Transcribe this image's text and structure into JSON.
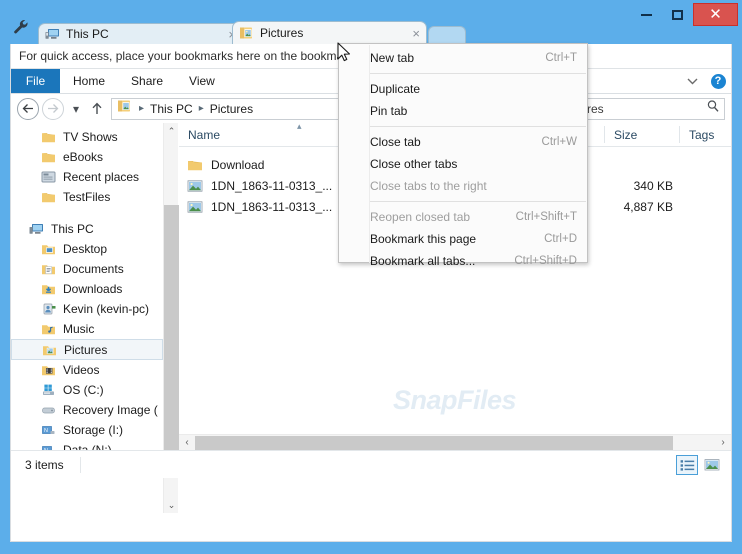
{
  "window": {
    "titlebar_color": "#5caeea",
    "close_color": "#d9534f",
    "wrench_icon": "wrench-icon",
    "minimize_label": "Minimize",
    "maximize_label": "Maximize",
    "close_label": "Close"
  },
  "tabs": [
    {
      "label": "This PC",
      "icon": "this-pc-icon",
      "active": false,
      "close": "×"
    },
    {
      "label": "Pictures",
      "icon": "pictures-folder-icon",
      "active": true,
      "close": "×"
    }
  ],
  "new_tab_button": {
    "label": "",
    "name": "new-tab-button"
  },
  "bookmark_bar": {
    "text": "For quick access, place your bookmarks here on the bookma"
  },
  "ribbon": {
    "file_label": "File",
    "tabs": [
      "Home",
      "Share",
      "View"
    ],
    "chevron": "⌵",
    "help_label": "?"
  },
  "address_bar": {
    "back": "←",
    "forward": "→",
    "history_caret": "▾",
    "up": "↑",
    "folder_icon": "folder-icon",
    "crumbs": [
      "This PC",
      "Pictures"
    ],
    "separator": "▸",
    "search_value": "res",
    "search_placeholder": "Search Pictures",
    "search_icon": "search-icon"
  },
  "nav_pane": {
    "groups": [
      {
        "items": [
          {
            "label": "TV Shows",
            "icon": "folder-icon",
            "indent": true,
            "selected": false
          },
          {
            "label": "eBooks",
            "icon": "folder-icon",
            "indent": true,
            "selected": false
          },
          {
            "label": "Recent places",
            "icon": "recent-places-icon",
            "indent": true,
            "selected": false
          },
          {
            "label": "TestFiles",
            "icon": "folder-icon",
            "indent": true,
            "selected": false
          }
        ]
      },
      {
        "items": [
          {
            "label": "This PC",
            "icon": "this-pc-icon",
            "indent": false,
            "selected": false
          },
          {
            "label": "Desktop",
            "icon": "desktop-folder-icon",
            "indent": true,
            "selected": false
          },
          {
            "label": "Documents",
            "icon": "documents-folder-icon",
            "indent": true,
            "selected": false
          },
          {
            "label": "Downloads",
            "icon": "downloads-folder-icon",
            "indent": true,
            "selected": false
          },
          {
            "label": "Kevin (kevin-pc)",
            "icon": "user-folder-icon",
            "indent": true,
            "selected": false
          },
          {
            "label": "Music",
            "icon": "music-folder-icon",
            "indent": true,
            "selected": false
          },
          {
            "label": "Pictures",
            "icon": "pictures-folder-icon",
            "indent": true,
            "selected": true
          },
          {
            "label": "Videos",
            "icon": "videos-folder-icon",
            "indent": true,
            "selected": false
          },
          {
            "label": "OS (C:)",
            "icon": "os-drive-icon",
            "indent": true,
            "selected": false
          },
          {
            "label": "Recovery Image (",
            "icon": "drive-icon",
            "indent": true,
            "selected": false
          },
          {
            "label": "Storage (I:)",
            "icon": "network-drive-icon",
            "indent": true,
            "selected": false
          },
          {
            "label": "Data (N:)",
            "icon": "network-drive-icon",
            "indent": true,
            "selected": false
          }
        ]
      }
    ]
  },
  "file_list": {
    "columns": [
      "Name",
      "",
      "Size",
      "Tags"
    ],
    "sort_caret": "▴",
    "rows": [
      {
        "name": "Download",
        "icon": "folder-icon",
        "date": "",
        "size": "",
        "tags": ""
      },
      {
        "name": "1DN_1863-11-0313_...",
        "icon": "image-file-icon",
        "date": "",
        "size": "340 KB",
        "tags": ""
      },
      {
        "name": "1DN_1863-11-0313_...",
        "icon": "image-file-icon",
        "date": "",
        "size": "4,887 KB",
        "tags": ""
      }
    ],
    "watermark": "SnapFiles"
  },
  "scrollbars": {
    "up_arrow": "⌃",
    "down_arrow": "⌄",
    "left_arrow": "‹",
    "right_arrow": "›"
  },
  "status_bar": {
    "items_text": "3 items",
    "view_details": "details-view-button",
    "view_large_icons": "large-icons-view-button"
  },
  "context_menu": {
    "groups": [
      [
        {
          "label": "New tab",
          "accel": "Ctrl+T",
          "disabled": false
        }
      ],
      [
        {
          "label": "Duplicate",
          "accel": "",
          "disabled": false
        },
        {
          "label": "Pin tab",
          "accel": "",
          "disabled": false
        }
      ],
      [
        {
          "label": "Close tab",
          "accel": "Ctrl+W",
          "disabled": false
        },
        {
          "label": "Close other tabs",
          "accel": "",
          "disabled": false
        },
        {
          "label": "Close tabs to the right",
          "accel": "",
          "disabled": true
        }
      ],
      [
        {
          "label": "Reopen closed tab",
          "accel": "Ctrl+Shift+T",
          "disabled": true
        },
        {
          "label": "Bookmark this page",
          "accel": "Ctrl+D",
          "disabled": false
        },
        {
          "label": "Bookmark all tabs...",
          "accel": "Ctrl+Shift+D",
          "disabled": false
        }
      ]
    ]
  }
}
